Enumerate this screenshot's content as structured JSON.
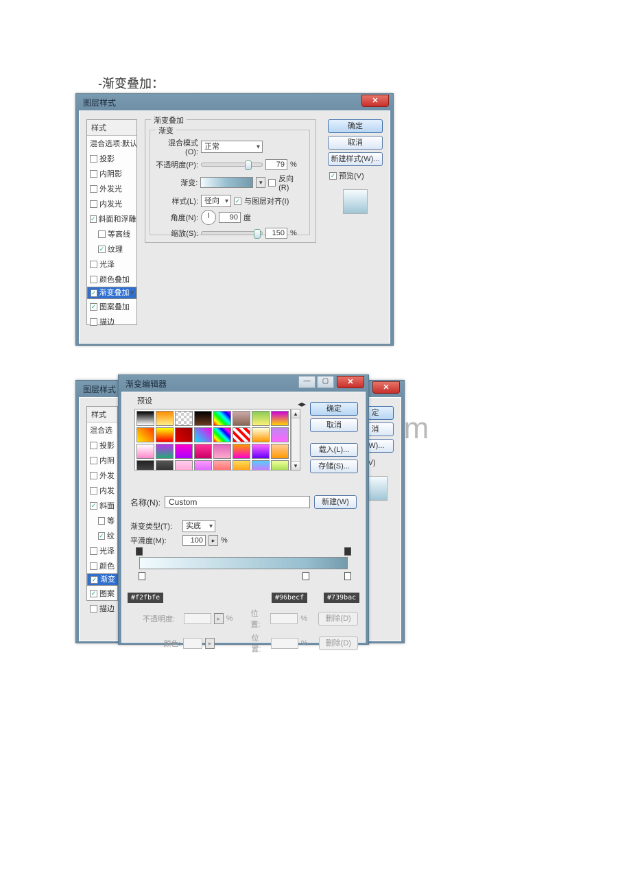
{
  "heading": "-渐变叠加：",
  "watermark": "docx.com",
  "top_win": {
    "title": "图层样式",
    "buttons": {
      "ok": "确定",
      "cancel": "取消",
      "new": "新建样式(W)...",
      "preview": "预览(V)"
    },
    "styles_header": "样式",
    "styles": [
      {
        "label": "混合选项:默认",
        "checked": false,
        "nocheck": true
      },
      {
        "label": "投影",
        "checked": false
      },
      {
        "label": "内阴影",
        "checked": false
      },
      {
        "label": "外发光",
        "checked": false
      },
      {
        "label": "内发光",
        "checked": false
      },
      {
        "label": "斜面和浮雕",
        "checked": true
      },
      {
        "label": "等高线",
        "checked": false,
        "indent": true
      },
      {
        "label": "纹理",
        "checked": true,
        "indent": true
      },
      {
        "label": "光泽",
        "checked": false
      },
      {
        "label": "颜色叠加",
        "checked": false
      },
      {
        "label": "渐变叠加",
        "checked": true,
        "selected": true
      },
      {
        "label": "图案叠加",
        "checked": true
      },
      {
        "label": "描边",
        "checked": false
      }
    ],
    "panel_title": "渐变叠加",
    "panel_sub": "渐变",
    "blend_label": "混合模式(O):",
    "blend_value": "正常",
    "opacity_label": "不透明度(P):",
    "opacity_value": "79",
    "pct": "%",
    "grad_label": "渐变:",
    "reverse": "反向(R)",
    "style_label": "样式(L):",
    "style_value": "径向",
    "align": "与图层对齐(I)",
    "angle_label": "角度(N):",
    "angle_value": "90",
    "deg": "度",
    "scale_label": "缩放(S):",
    "scale_value": "150"
  },
  "editor": {
    "title": "渐变编辑器",
    "presets": "预设",
    "ok": "确定",
    "cancel": "取消",
    "load": "载入(L)...",
    "save": "存储(S)...",
    "name_label": "名称(N):",
    "name_value": "Custom",
    "new_btn": "新建(W)",
    "type_label": "渐变类型(T):",
    "type_value": "实底",
    "smooth_label": "平滑度(M):",
    "smooth_value": "100",
    "pct": "%",
    "hex1": "#f2fbfe",
    "hex2": "#96becf",
    "hex3": "#739bac",
    "opacity_lbl": "不透明度:",
    "pos_lbl": "位置:",
    "delete_lbl": "删除(D)",
    "color_lbl": "颜色:",
    "bg_styles_header": "样式",
    "bg_styles": [
      {
        "label": "混合选",
        "nocheck": true
      },
      {
        "label": "投影"
      },
      {
        "label": "内阴"
      },
      {
        "label": "外发"
      },
      {
        "label": "内发"
      },
      {
        "label": "斜面",
        "checked": true
      },
      {
        "label": "等",
        "indent": true
      },
      {
        "label": "纹",
        "checked": true,
        "indent": true
      },
      {
        "label": "光泽"
      },
      {
        "label": "颜色"
      },
      {
        "label": "渐变",
        "checked": true,
        "selected": true
      },
      {
        "label": "图案",
        "checked": true
      },
      {
        "label": "描边"
      }
    ],
    "bg_buttons": {
      "ok_cut": "定",
      "cancel_cut": "消",
      "new_cut": "(W)...",
      "prev_cut": "览(V)"
    }
  },
  "swatches": [
    "linear-gradient(#000,#fff)",
    "linear-gradient(#ff8c00,#ffef8c)",
    "repeating-conic-gradient(#ccc 0 25%,#fff 0 50%) 0/8px 8px",
    "linear-gradient(#000,#6b3b1f)",
    "linear-gradient(45deg,#f00,#ff0,#0f0,#0ff,#00f,#f0f)",
    "linear-gradient(#caa,#865)",
    "linear-gradient(#8c5,#fff176)",
    "linear-gradient(#c0d,#ffd400)",
    "linear-gradient(45deg,#ffea00,#ff3d00)",
    "linear-gradient(#ff0,#f00)",
    "linear-gradient(45deg,#d00,#900)",
    "linear-gradient(45deg,#00e5ff,#ff00e5)",
    "linear-gradient(45deg,#f00,#ff0,#0f0,#0ff,#00f,#f0f,#f00)",
    "repeating-linear-gradient(45deg,#f00 0 4px,#fff 4px 8px)",
    "linear-gradient(#ffd,#f90)",
    "linear-gradient(#b8e,#f6f)",
    "linear-gradient(#fff,#f8c)",
    "linear-gradient(#b3e,#2a7)",
    "linear-gradient(#f0c,#a0f)",
    "linear-gradient(#f39,#c06)",
    "linear-gradient(#d6b,#fac)",
    "linear-gradient(#f90,#f0c)",
    "linear-gradient(#f6f,#60f)",
    "linear-gradient(#fc9,#f90)",
    "linear-gradient(#222,#555)",
    "linear-gradient(#555,#222)",
    "linear-gradient(#fce,#f9c)",
    "linear-gradient(#f9f,#c5f)",
    "linear-gradient(#faa,#f55)",
    "linear-gradient(#fd5,#f80)",
    "linear-gradient(#5cf,#f5f)",
    "linear-gradient(#ef9,#8c3)"
  ]
}
